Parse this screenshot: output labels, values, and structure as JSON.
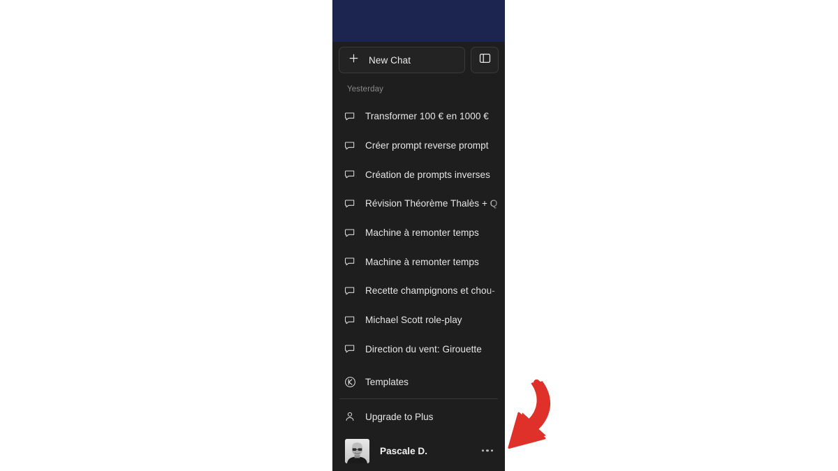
{
  "window": {
    "background_color": "#ffffff",
    "sidebar_background": "#1e1e1e",
    "app_header_color": "#1c2450",
    "accent_annotation_color": "#e0302a"
  },
  "sidebar": {
    "top_bar": {
      "new_chat": {
        "label": "New Chat",
        "icon": "plus-icon"
      },
      "panel_toggle": {
        "icon": "sidebar-panel-icon",
        "label": ""
      }
    },
    "section_label": "Yesterday",
    "chats": [
      {
        "title": "Transformer 100 € en 1000 €",
        "icon": "chat-bubble-icon"
      },
      {
        "title": "Créer prompt reverse prompt",
        "icon": "chat-bubble-icon"
      },
      {
        "title": "Création de prompts inverses",
        "icon": "chat-bubble-icon"
      },
      {
        "title": "Révision Théorème Thalès + Q",
        "icon": "chat-bubble-icon"
      },
      {
        "title": "Machine à remonter temps",
        "icon": "chat-bubble-icon"
      },
      {
        "title": "Machine à remonter temps",
        "icon": "chat-bubble-icon"
      },
      {
        "title": "Recette champignons et chou-",
        "icon": "chat-bubble-icon"
      },
      {
        "title": "Michael Scott role-play",
        "icon": "chat-bubble-icon"
      },
      {
        "title": "Direction du vent: Girouette",
        "icon": "chat-bubble-icon"
      }
    ],
    "templates": {
      "label": "Templates",
      "icon": "circled-k-icon"
    },
    "upgrade": {
      "label": "Upgrade to Plus",
      "icon": "person-icon"
    },
    "account": {
      "name": "Pascale D.",
      "avatar": "user-avatar-photo",
      "more_menu_icon": "ellipsis-icon"
    }
  },
  "annotation": {
    "arrow": "curved-red-arrow",
    "points_at": "account-more-menu"
  }
}
